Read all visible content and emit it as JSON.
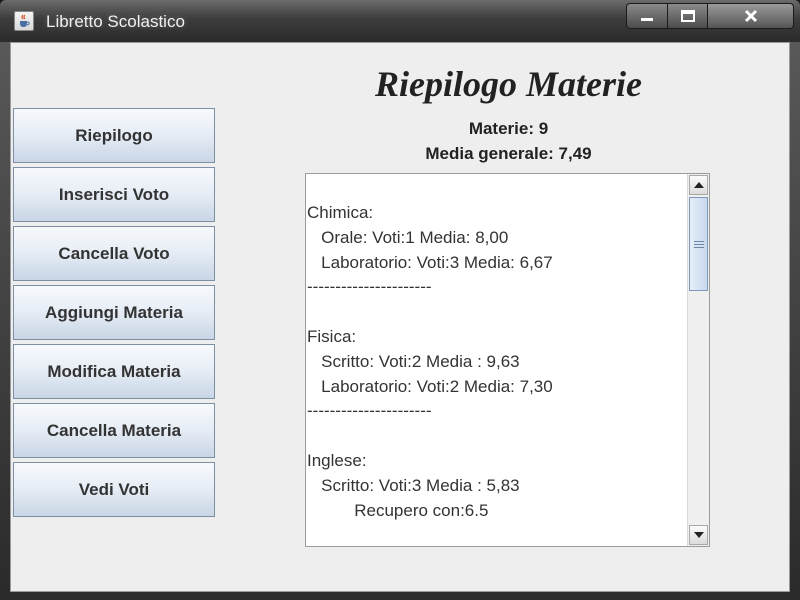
{
  "window": {
    "title": "Libretto Scolastico",
    "icon": "java-cup-icon"
  },
  "controls": {
    "minimize": "minimize-icon",
    "maximize": "maximize-icon",
    "close": "close-icon"
  },
  "sidebar": {
    "buttons": [
      {
        "label": "Riepilogo"
      },
      {
        "label": "Inserisci Voto"
      },
      {
        "label": "Cancella Voto"
      },
      {
        "label": "Aggiungi Materia"
      },
      {
        "label": "Modifica Materia"
      },
      {
        "label": "Cancella Materia"
      },
      {
        "label": "Vedi Voti"
      }
    ]
  },
  "main": {
    "title": "Riepilogo Materie",
    "subjects_count": "Materie: 9",
    "overall_average": "Media generale: 7,49",
    "summary_lines": [
      "Chimica:",
      "   Orale: Voti:1 Media: 8,00",
      "   Laboratorio: Voti:3 Media: 6,67",
      "----------------------",
      "",
      "Fisica:",
      "   Scritto: Voti:2 Media : 9,63",
      "   Laboratorio: Voti:2 Media: 7,30",
      "----------------------",
      "",
      "Inglese:",
      "   Scritto: Voti:3 Media : 5,83",
      "          Recupero con:6.5"
    ]
  },
  "colors": {
    "button_gradient_top": "#f7f9fc",
    "button_gradient_bottom": "#c9d6e6",
    "button_border": "#7d8fa3",
    "panel_bg": "#eeeeee"
  }
}
